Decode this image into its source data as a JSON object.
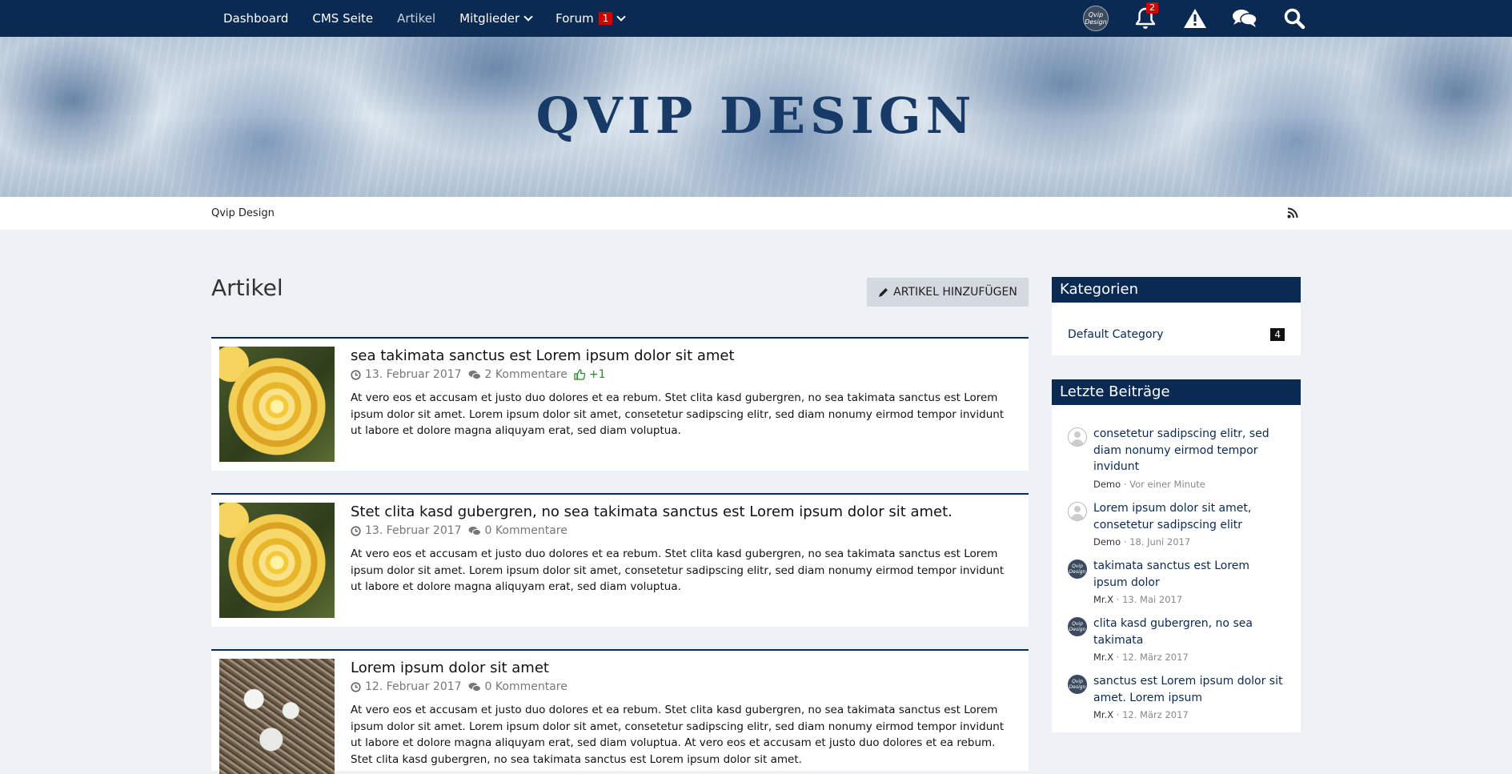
{
  "nav": {
    "items": [
      {
        "label": "Dashboard"
      },
      {
        "label": "CMS Seite"
      },
      {
        "label": "Artikel"
      },
      {
        "label": "Mitglieder"
      },
      {
        "label": "Forum",
        "badge": "1"
      }
    ],
    "avatar_text": "Qvip Design",
    "notification_count": "2",
    "icons": [
      "avatar",
      "bell-icon",
      "warning-icon",
      "chat-icon",
      "search-icon"
    ]
  },
  "banner": {
    "title": "QVIP DESIGN"
  },
  "breadcrumb": {
    "label": "Qvip Design",
    "rss_icon": "rss-icon"
  },
  "main": {
    "title": "Artikel",
    "add_button_label": "ARTIKEL HINZUFÜGEN",
    "articles": [
      {
        "title": "sea takimata sanctus est Lorem ipsum dolor sit amet",
        "date": "13. Februar 2017",
        "comments": "2 Kommentare",
        "likes": "+1",
        "excerpt": "At vero eos et accusam et justo duo dolores et ea rebum. Stet clita kasd gubergren, no sea takimata sanctus est Lorem ipsum dolor sit amet. Lorem ipsum dolor sit amet, consetetur sadipscing elitr, sed diam nonumy eirmod tempor invidunt ut labore et dolore magna aliquyam erat, sed diam voluptua."
      },
      {
        "title": "Stet clita kasd gubergren, no sea takimata sanctus est Lorem ipsum dolor sit amet.",
        "date": "13. Februar 2017",
        "comments": "0 Kommentare",
        "excerpt": "At vero eos et accusam et justo duo dolores et ea rebum. Stet clita kasd gubergren, no sea takimata sanctus est Lorem ipsum dolor sit amet. Lorem ipsum dolor sit amet, consetetur sadipscing elitr, sed diam nonumy eirmod tempor invidunt ut labore et dolore magna aliquyam erat, sed diam voluptua."
      },
      {
        "title": "Lorem ipsum dolor sit amet",
        "date": "12. Februar 2017",
        "comments": "0 Kommentare",
        "excerpt": "At vero eos et accusam et justo duo dolores et ea rebum. Stet clita kasd gubergren, no sea takimata sanctus est Lorem ipsum dolor sit amet. Lorem ipsum dolor sit amet, consetetur sadipscing elitr, sed diam nonumy eirmod tempor invidunt ut labore et dolore magna aliquyam erat, sed diam voluptua. At vero eos et accusam et justo duo dolores et ea rebum. Stet clita kasd gubergren, no sea takimata sanctus est Lorem ipsum dolor sit amet."
      }
    ]
  },
  "sidebar": {
    "categories": {
      "title": "Kategorien",
      "items": [
        {
          "label": "Default Category",
          "count": "4"
        }
      ]
    },
    "latest": {
      "title": "Letzte Beiträge",
      "posts": [
        {
          "title": "consetetur sadipscing elitr, sed diam nonumy eirmod tempor invidunt",
          "author": "Demo",
          "time": "Vor einer Minute",
          "avatar": "default-avatar"
        },
        {
          "title": "Lorem ipsum dolor sit amet, consetetur sadipscing elitr",
          "author": "Demo",
          "time": "18. Juni 2017",
          "avatar": "default-avatar"
        },
        {
          "title": "takimata sanctus est Lorem ipsum dolor",
          "author": "Mr.X",
          "time": "13. Mai 2017",
          "avatar": "qvip-logo-avatar"
        },
        {
          "title": "clita kasd gubergren, no sea takimata",
          "author": "Mr.X",
          "time": "12. März 2017",
          "avatar": "qvip-logo-avatar"
        },
        {
          "title": "sanctus est Lorem ipsum dolor sit amet. Lorem ipsum",
          "author": "Mr.X",
          "time": "12. März 2017",
          "avatar": "qvip-logo-avatar"
        }
      ]
    }
  },
  "colors": {
    "primary": "#0a2a52",
    "badge": "#d10000",
    "background": "#eef2f6",
    "like": "#2b8a2b"
  }
}
